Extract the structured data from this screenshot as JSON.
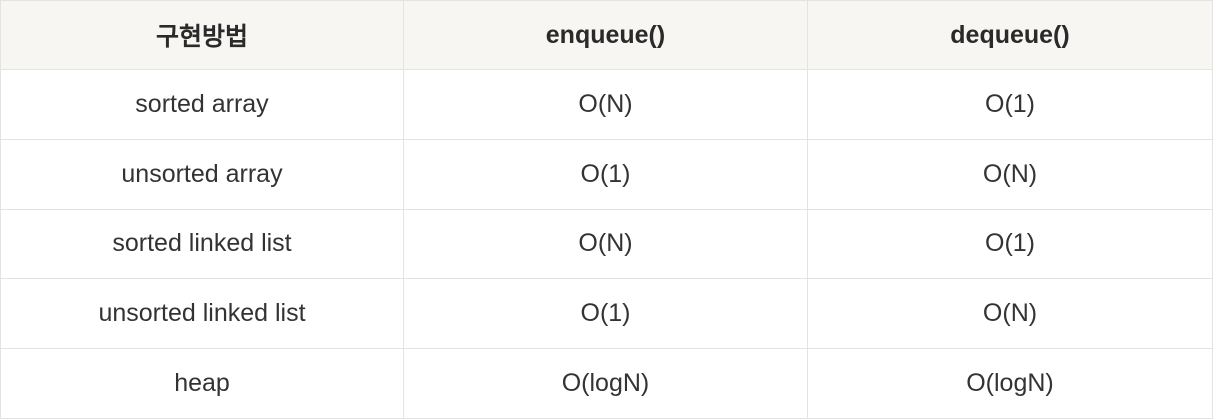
{
  "table": {
    "headers": [
      "구현방법",
      "enqueue()",
      "dequeue()"
    ],
    "rows": [
      [
        "sorted array",
        "O(N)",
        "O(1)"
      ],
      [
        "unsorted array",
        "O(1)",
        "O(N)"
      ],
      [
        "sorted linked list",
        "O(N)",
        "O(1)"
      ],
      [
        "unsorted linked list",
        "O(1)",
        "O(N)"
      ],
      [
        "heap",
        "O(logN)",
        "O(logN)"
      ]
    ]
  },
  "colors": {
    "header_background": "#f7f6f3",
    "border": "#e3e3e3",
    "text": "#333333"
  }
}
